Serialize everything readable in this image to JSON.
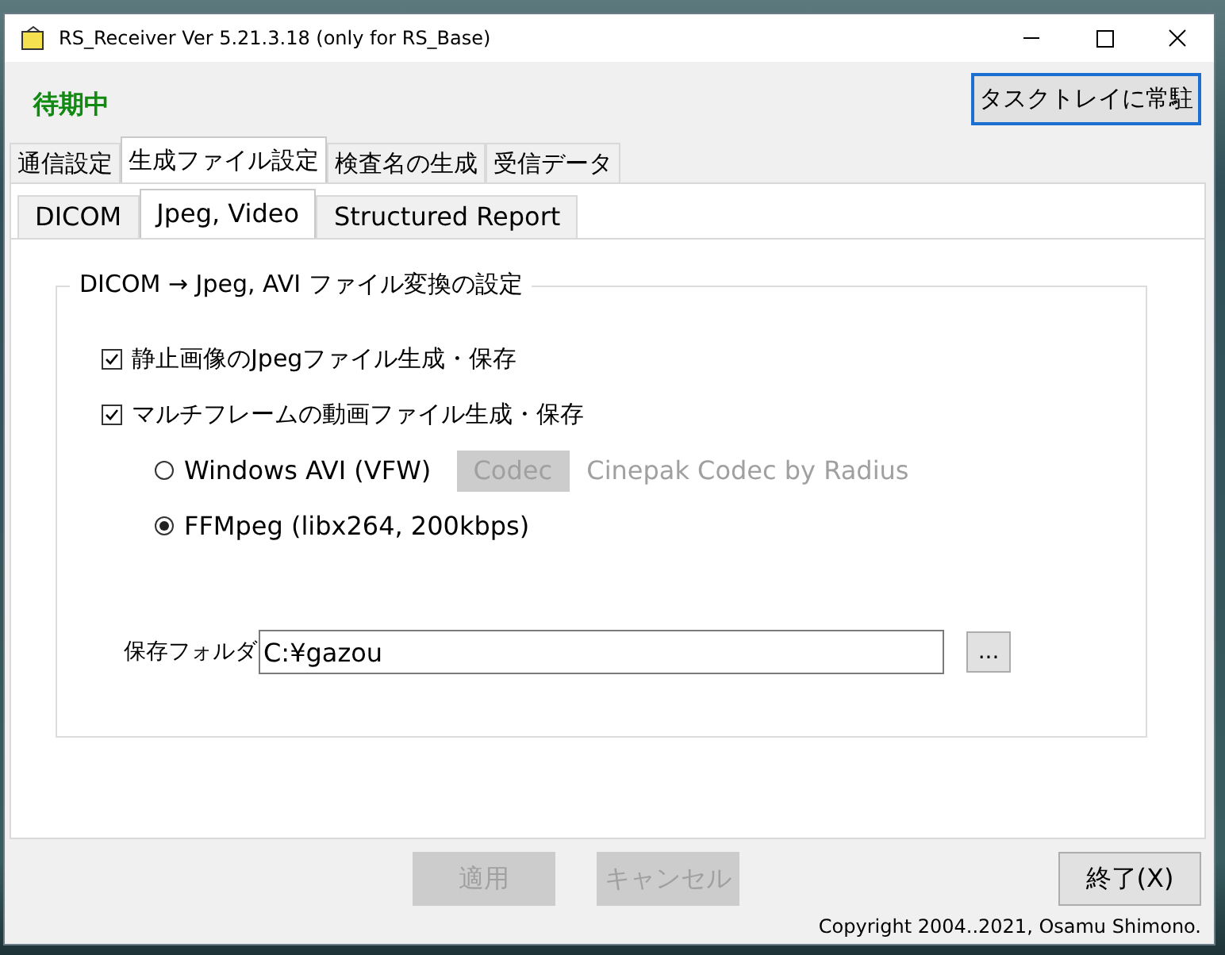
{
  "window": {
    "title": "RS_Receiver Ver 5.21.3.18  (only for RS_Base)"
  },
  "status": {
    "text": "待期中"
  },
  "tray_button": {
    "label": "タスクトレイに常駐"
  },
  "tabs": [
    {
      "label": "通信設定",
      "selected": false
    },
    {
      "label": "生成ファイル設定",
      "selected": true
    },
    {
      "label": "検査名の生成",
      "selected": false
    },
    {
      "label": "受信データ",
      "selected": false
    }
  ],
  "subtabs": [
    {
      "label": "DICOM",
      "selected": false
    },
    {
      "label": "Jpeg, Video",
      "selected": true
    },
    {
      "label": "Structured Report",
      "selected": false
    }
  ],
  "group": {
    "title": "DICOM → Jpeg, AVI ファイル変換の設定",
    "checkboxes": [
      {
        "label": "静止画像のJpegファイル生成・保存",
        "checked": true
      },
      {
        "label": "マルチフレームの動画ファイル生成・保存",
        "checked": true
      }
    ],
    "radios": [
      {
        "label": "Windows AVI (VFW)",
        "selected": false,
        "codec_button": {
          "label": "Codec",
          "disabled": true
        },
        "codec_name": {
          "text": "Cinepak Codec by Radius",
          "disabled": true
        }
      },
      {
        "label": "FFMpeg (libx264, 200kbps)",
        "selected": true
      }
    ],
    "folder": {
      "label": "保存フォルダ",
      "value": "C:¥gazou",
      "browse": "..."
    }
  },
  "buttons": [
    {
      "label": "適用",
      "disabled": true
    },
    {
      "label": "キャンセル",
      "disabled": true
    },
    {
      "label": "終了(X)",
      "disabled": false
    }
  ],
  "copyright": "Copyright 2004..2021, Osamu Shimono."
}
